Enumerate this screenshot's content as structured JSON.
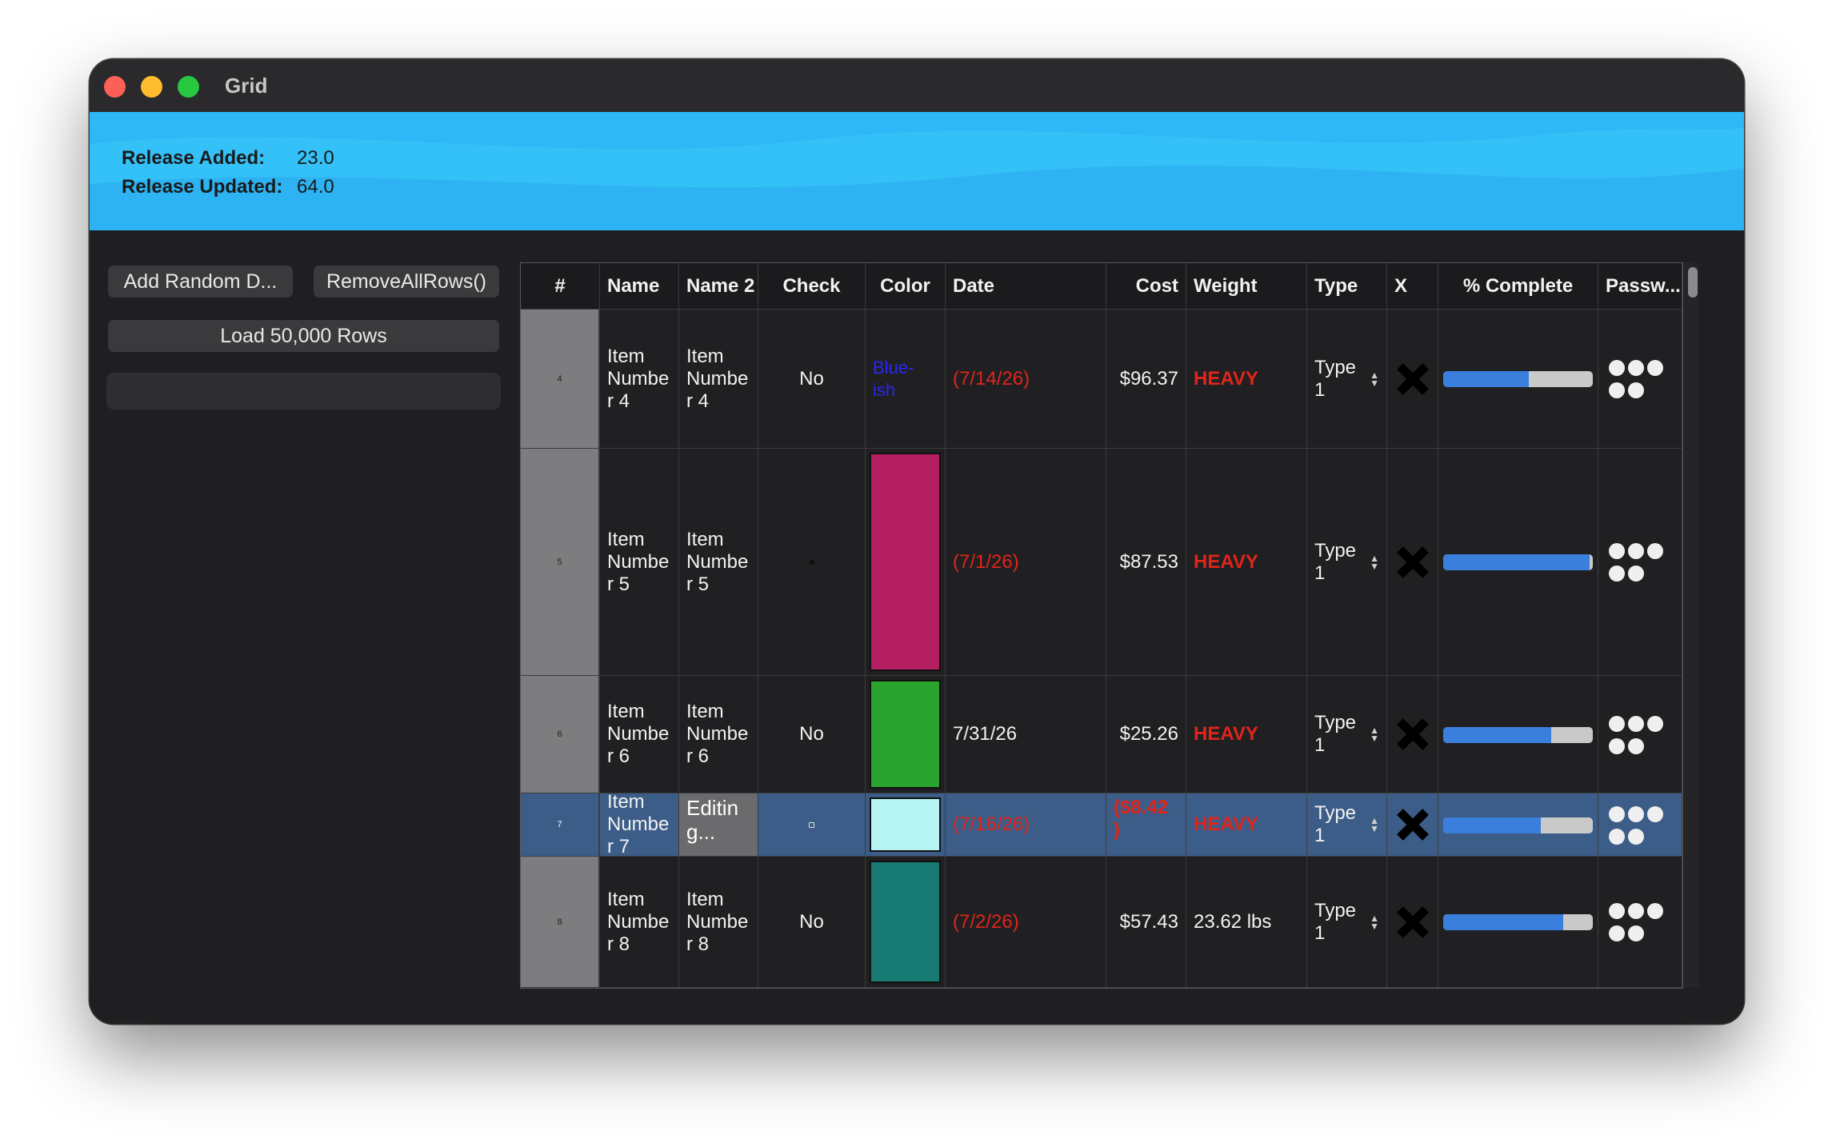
{
  "window": {
    "title": "Grid"
  },
  "banner": {
    "release_added_label": "Release Added:",
    "release_added_value": "23.0",
    "release_updated_label": "Release Updated:",
    "release_updated_value": "64.0"
  },
  "sidebar": {
    "add_random_label": "Add Random D...",
    "remove_all_label": "RemoveAllRows()",
    "load_rows_label": "Load 50,000 Rows"
  },
  "grid": {
    "columns": [
      "#",
      "Name",
      "Name 2",
      "Check",
      "Color",
      "Date",
      "Cost",
      "Weight",
      "Type",
      "X",
      "% Complete",
      "Passw..."
    ],
    "rows": [
      {
        "num": "4",
        "name": "Item Numbe r 4",
        "name2": "Item Numbe r 4",
        "check": "No",
        "color_text": "Blue- ish",
        "date": "(7/14/26)",
        "cost": "$96.37",
        "weight": "HEAVY",
        "type": "Type 1",
        "complete": 0.57
      },
      {
        "num": "5",
        "name": "Item Numbe r 5",
        "name2": "Item Numbe r 5",
        "check": "",
        "color": "#b41f62",
        "date": "(7/1/26)",
        "cost": "$87.53",
        "weight": "HEAVY",
        "type": "Type 1",
        "complete": 0.98
      },
      {
        "num": "6",
        "name": "Item Numbe r 6",
        "name2": "Item Numbe r 6",
        "check": "No",
        "color": "#2aa22e",
        "date": "7/31/26",
        "cost": "$25.26",
        "weight": "HEAVY",
        "type": "Type 1",
        "complete": 0.72
      },
      {
        "num": "7",
        "name": "Item Numbe r 7",
        "name2": "Editin g...",
        "check": "",
        "color": "#b6f5f3",
        "date": "(7/16/26)",
        "cost": "($8.42 )",
        "weight": "HEAVY",
        "type": "Type 1",
        "complete": 0.65
      },
      {
        "num": "8",
        "name": "Item Numbe r 8",
        "name2": "Item Numbe r 8",
        "check": "No",
        "color": "#177b74",
        "date": "(7/2/26)",
        "cost": "$57.43",
        "weight": "23.62 lbs",
        "type": "Type 1",
        "complete": 0.8
      }
    ]
  },
  "icons": {
    "delete": "x-icon",
    "password": "password-dots-icon",
    "stepper": "stepper-arrows-icon"
  },
  "colors": {
    "banner": "#2fb8f6",
    "negative": "#e0251b",
    "selection": "#3c5d87",
    "progress": "#3a7fdc"
  }
}
